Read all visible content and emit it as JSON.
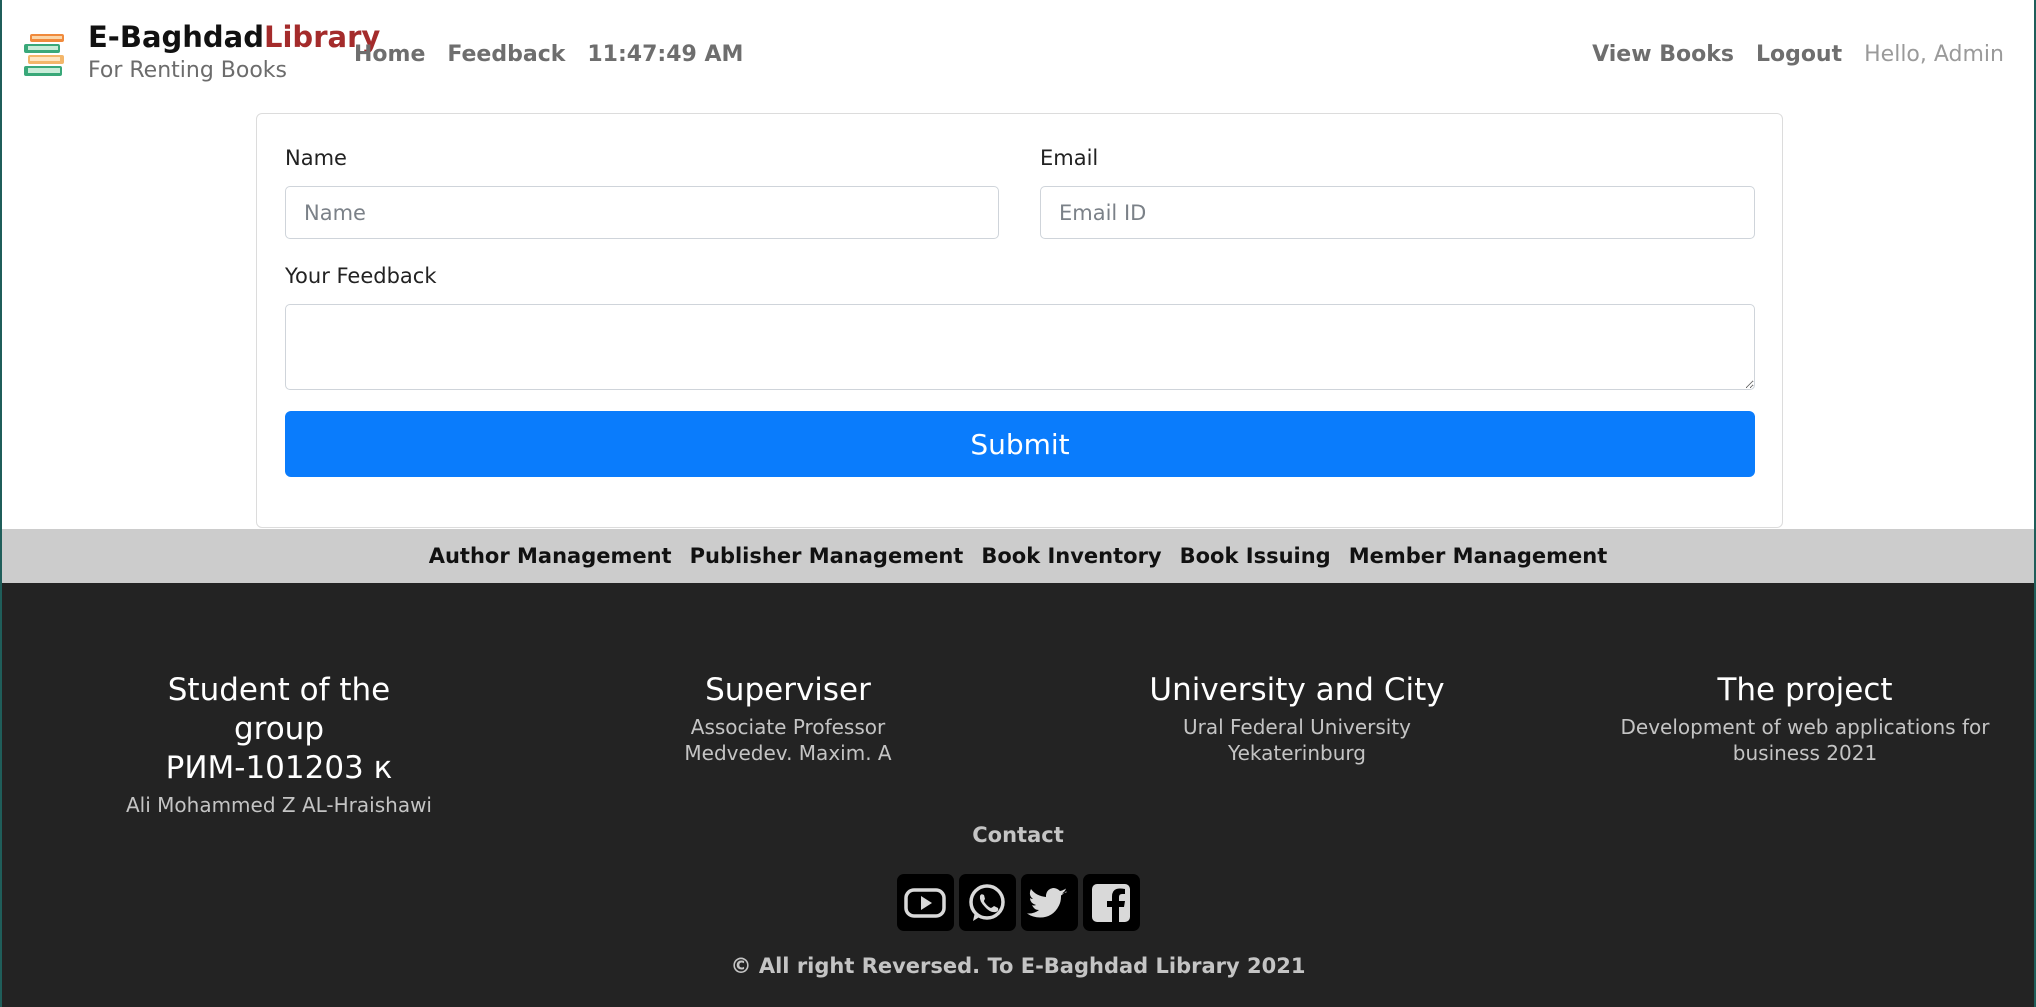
{
  "navbar": {
    "logo_icon": "books-stack-icon",
    "brand_main": "E-Baghdad",
    "brand_accent": "Library",
    "tagline": "For Renting Books",
    "links": [
      "Home",
      "Feedback"
    ],
    "clock": "11:47:49 AM",
    "right_links": [
      "View Books",
      "Logout"
    ],
    "greeting": "Hello, Admin"
  },
  "form": {
    "name_label": "Name",
    "name_placeholder": "Name",
    "email_label": "Email",
    "email_placeholder": "Email ID",
    "feedback_label": "Your Feedback",
    "feedback_value": "",
    "submit_label": "Submit"
  },
  "management": {
    "links": [
      "Author Management",
      "Publisher Management",
      "Book Inventory",
      "Book Issuing",
      "Member Management"
    ]
  },
  "footer": {
    "columns": [
      {
        "title": "Student of the group РИМ-101203 к",
        "lines": [
          "Ali Mohammed Z AL-Hraishawi"
        ]
      },
      {
        "title": "Superviser",
        "lines": [
          "Associate Professor",
          "Medvedev. Maxim. A"
        ]
      },
      {
        "title": "University and City",
        "lines": [
          "Ural Federal University",
          "Yekaterinburg"
        ]
      },
      {
        "title": "The project",
        "lines": [
          "Development of web applications for business 2021"
        ]
      }
    ],
    "contact_title": "Contact",
    "social_icons": [
      "youtube-icon",
      "whatsapp-icon",
      "twitter-icon",
      "facebook-icon"
    ],
    "copyright": "© All right Reversed. To E-Baghdad Library 2021"
  },
  "colors": {
    "brand_accent": "#a42b2b",
    "submit_button": "#0a7cfc",
    "management_bar": "#cccccc",
    "footer_background": "#232323"
  }
}
